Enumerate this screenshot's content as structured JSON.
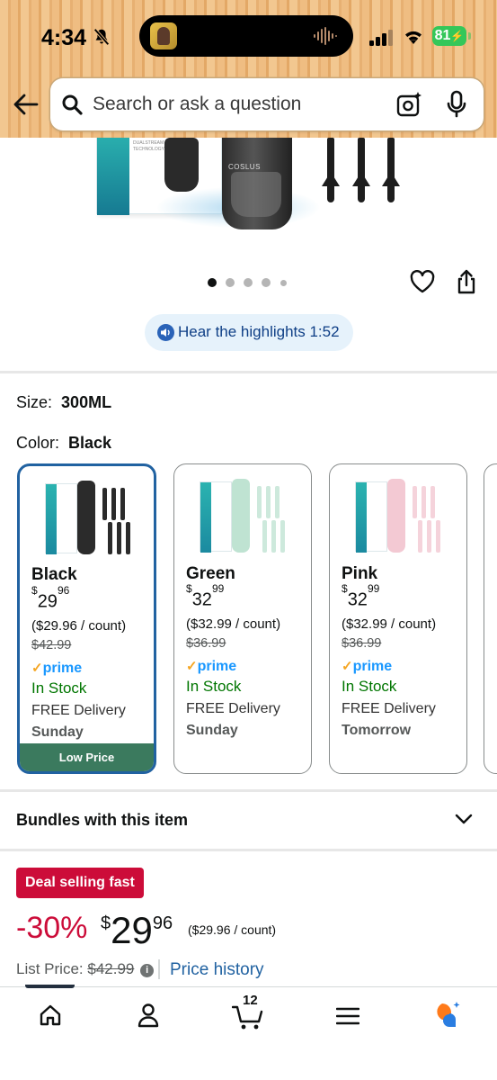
{
  "status_bar": {
    "time": "4:34",
    "battery": "81"
  },
  "search": {
    "placeholder": "Search or ask a question"
  },
  "product_image": {
    "brand_text": "COSLUS",
    "box_text": "DUALSTREAM TECHNOLOGY"
  },
  "carousel": {
    "dots": 5,
    "active_index": 0
  },
  "audio": {
    "label": "Hear the highlights 1:52"
  },
  "size": {
    "label": "Size:",
    "value": "300ML"
  },
  "color": {
    "label": "Color:",
    "value": "Black"
  },
  "variants": [
    {
      "name": "Black",
      "price_symbol": "$",
      "price_whole": "29",
      "price_cents": "96",
      "per_count": "($29.96 / count)",
      "list_price": "$42.99",
      "prime": "prime",
      "stock": "In Stock",
      "delivery": "FREE Delivery",
      "day": "Sunday",
      "badge": "Low Price",
      "color_hex": "#2b2b2b"
    },
    {
      "name": "Green",
      "price_symbol": "$",
      "price_whole": "32",
      "price_cents": "99",
      "per_count": "($32.99 / count)",
      "list_price": "$36.99",
      "prime": "prime",
      "stock": "In Stock",
      "delivery": "FREE Delivery",
      "day": "Sunday",
      "color_hex": "#bfe3d2"
    },
    {
      "name": "Pink",
      "price_symbol": "$",
      "price_whole": "32",
      "price_cents": "99",
      "per_count": "($32.99 / count)",
      "list_price": "$36.99",
      "prime": "prime",
      "stock": "In Stock",
      "delivery": "FREE Delivery",
      "day": "Tomorrow",
      "color_hex": "#f3c9d3"
    }
  ],
  "bundles": {
    "label": "Bundles with this item"
  },
  "deal": {
    "badge": "Deal selling fast",
    "discount": "-30%",
    "price_symbol": "$",
    "price_whole": "29",
    "price_cents": "96",
    "per_count": "($29.96 / count)",
    "list_price_label": "List Price:",
    "list_price": "$42.99",
    "price_history": "Price history"
  },
  "nav": {
    "cart_count": "12",
    "items": [
      "home-icon",
      "account-icon",
      "cart-icon",
      "menu-icon",
      "rufus-icon"
    ]
  },
  "colors": {
    "accent_blue": "#2162a1",
    "deal_red": "#cc0c39",
    "stock_green": "#007600",
    "badge_green": "#3b7a5e"
  }
}
